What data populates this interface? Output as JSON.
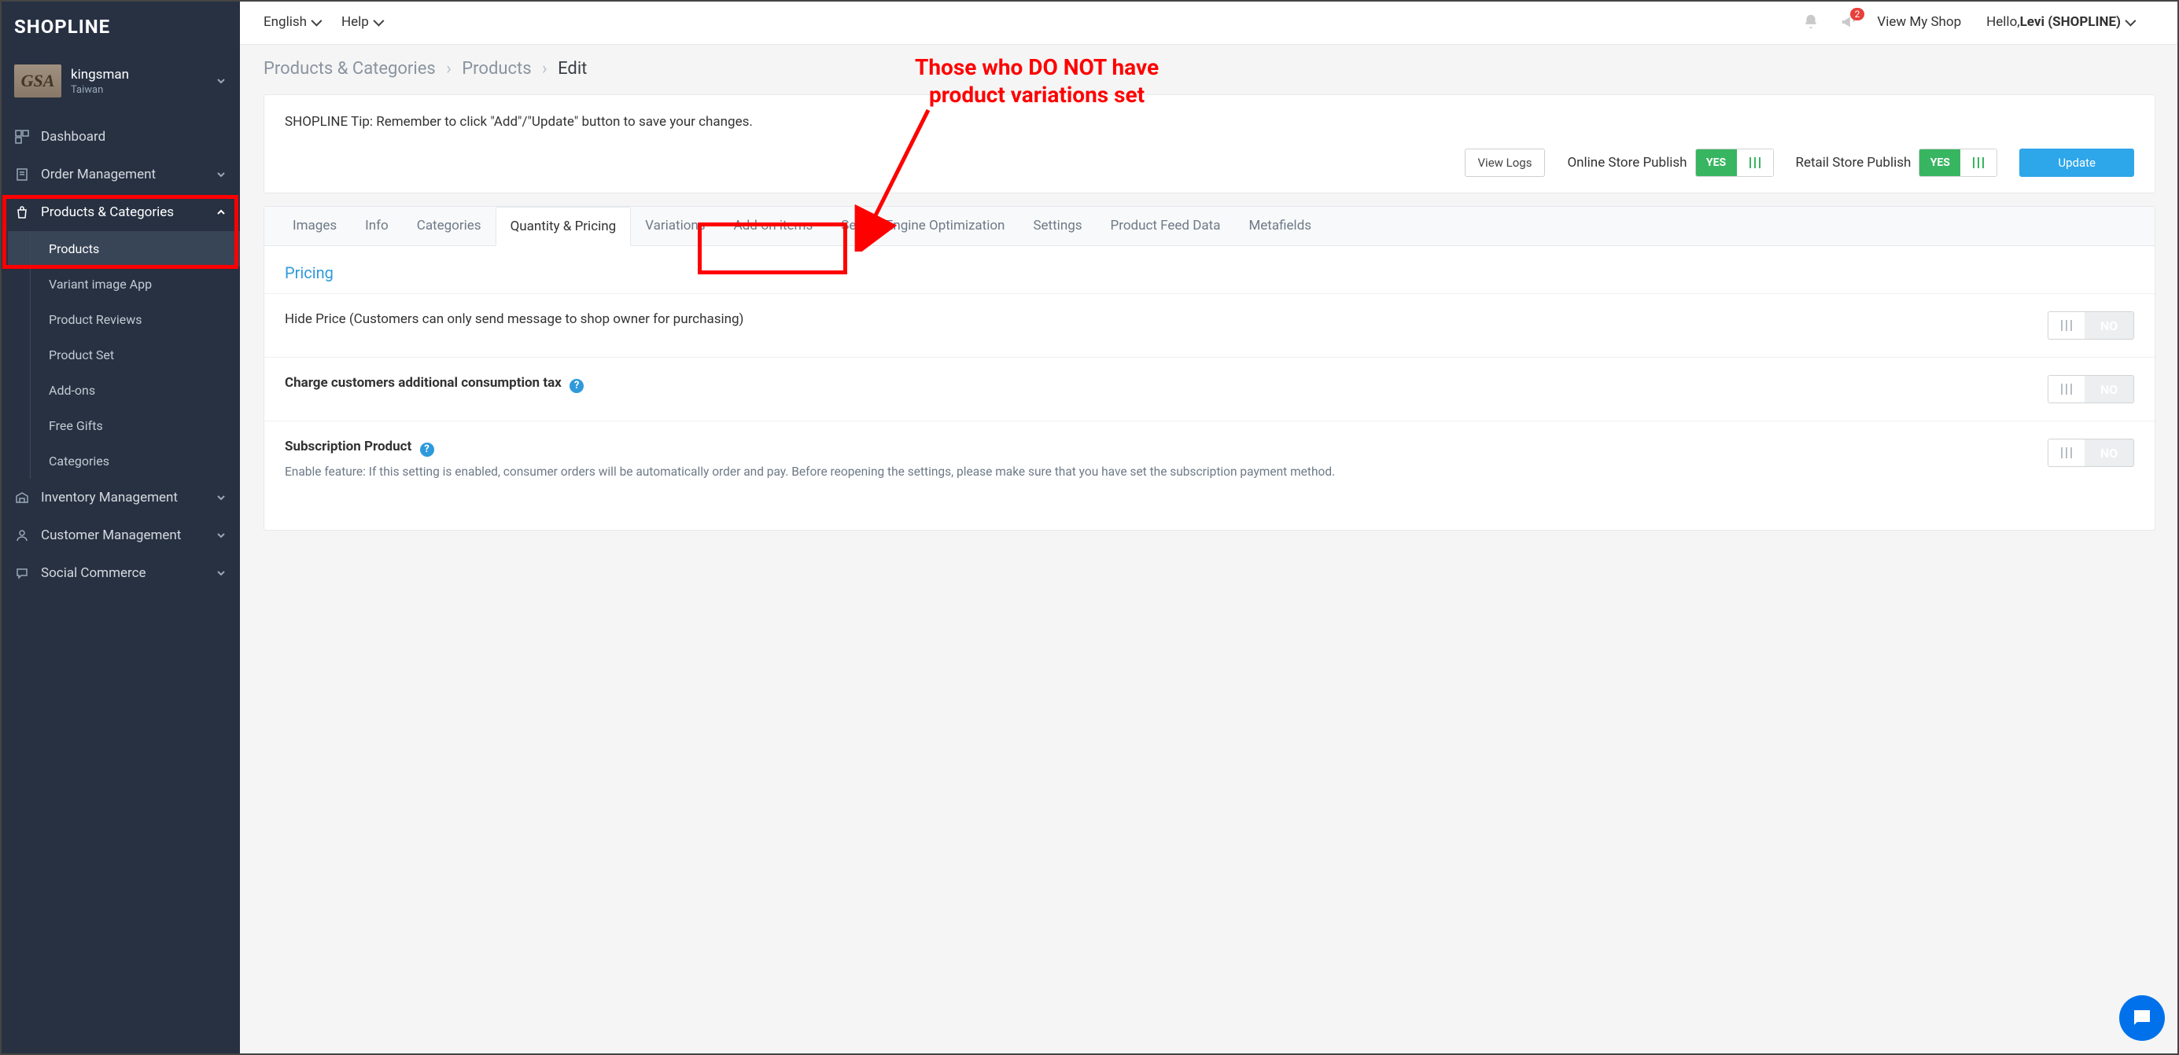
{
  "logo": "SHOPLINE",
  "shop": {
    "avatar": "GSA",
    "name": "kingsman",
    "region": "Taiwan"
  },
  "nav": {
    "dashboard": "Dashboard",
    "orders": "Order Management",
    "products": "Products & Categories",
    "inventory": "Inventory Management",
    "customers": "Customer Management",
    "social": "Social Commerce"
  },
  "subnav": {
    "products": "Products",
    "variant_image": "Variant image App",
    "reviews": "Product Reviews",
    "product_set": "Product Set",
    "add_ons": "Add-ons",
    "free_gifts": "Free Gifts",
    "categories": "Categories"
  },
  "topbar": {
    "language": "English",
    "help": "Help",
    "view_shop": "View My Shop",
    "hello_prefix": "Hello, ",
    "user": "Levi (SHOPLINE)",
    "badge": "2"
  },
  "crumbs": {
    "a": "Products & Categories",
    "b": "Products",
    "c": "Edit"
  },
  "tip": "SHOPLINE Tip: Remember to click \"Add\"/\"Update\" button to save your changes.",
  "actions": {
    "view_logs": "View Logs",
    "online_publish": "Online Store Publish",
    "retail_publish": "Retail Store Publish",
    "yes": "YES",
    "no": "NO",
    "update": "Update"
  },
  "tabs": {
    "images": "Images",
    "info": "Info",
    "categories": "Categories",
    "quantity": "Quantity & Pricing",
    "variations": "Variations",
    "addon": "Add-on items",
    "seo": "Search Engine Optimization",
    "settings": "Settings",
    "feed": "Product Feed Data",
    "metafields": "Metafields"
  },
  "pricing": {
    "title": "Pricing",
    "hide_price": "Hide Price (Customers can only send message to shop owner for purchasing)",
    "tax": "Charge customers additional consumption tax",
    "subscription_title": "Subscription Product",
    "subscription_desc": "Enable feature: If this setting is enabled, consumer orders will be automatically order and pay. Before reopening the settings, please make sure that you have set the subscription payment method."
  },
  "callout": "Those who DO NOT have product variations set"
}
